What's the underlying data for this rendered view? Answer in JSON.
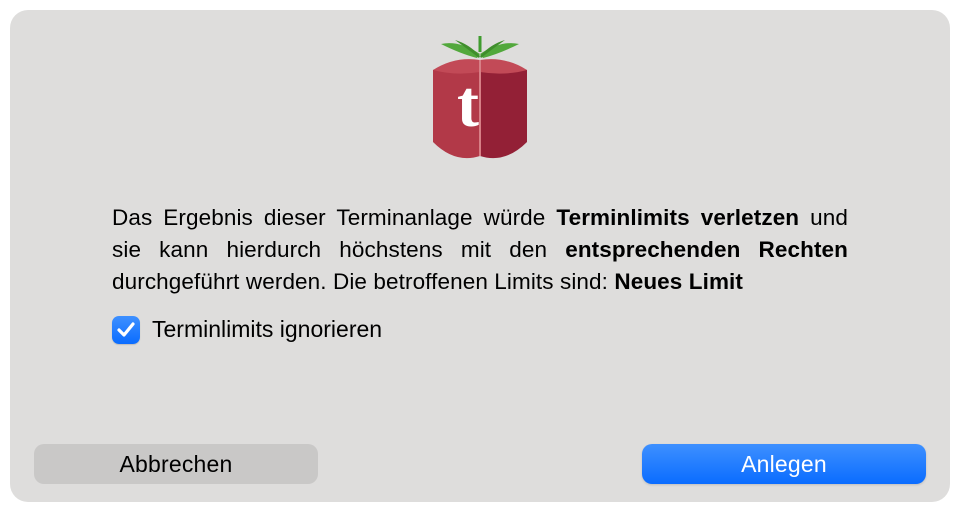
{
  "icon": {
    "letter": "t",
    "name": "tomato-app-icon"
  },
  "message": {
    "part1": "Das Ergebnis dieser Terminanlage würde ",
    "bold1": "Terminlimits verletzen",
    "part2": " und sie kann hierdurch höchstens mit den ",
    "bold2": "entsprechenden Rechten",
    "part3": " durchgeführt werden. Die betroffenen Limits sind: ",
    "bold3": "Neues Limit"
  },
  "checkbox": {
    "label": "Terminlimits ignorieren",
    "checked": true
  },
  "buttons": {
    "cancel": "Abbrechen",
    "confirm": "Anlegen"
  }
}
